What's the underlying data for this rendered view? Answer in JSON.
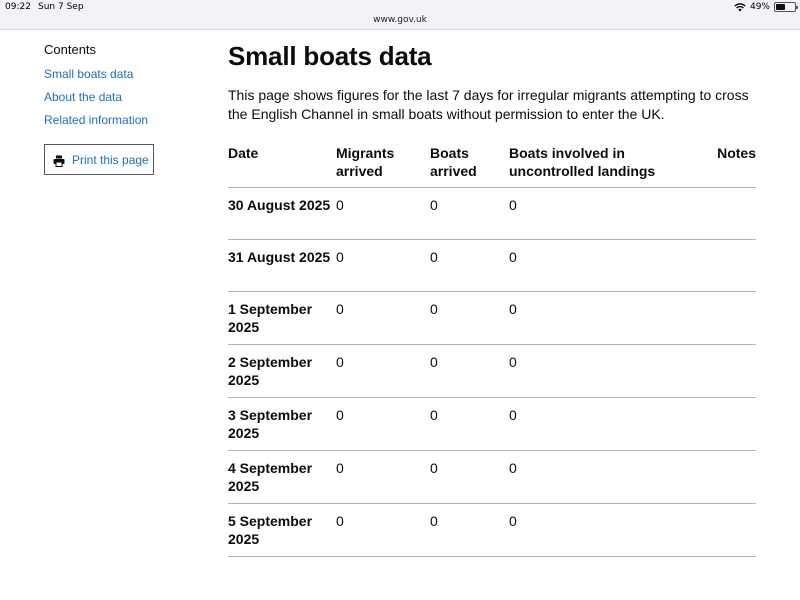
{
  "status_bar": {
    "time": "09:22",
    "date": "Sun 7 Sep",
    "url": "www.gov.uk",
    "battery": "49%",
    "battery_level": 0.49
  },
  "sidebar": {
    "heading": "Contents",
    "items": [
      {
        "label": "Small boats data"
      },
      {
        "label": "About the data"
      },
      {
        "label": "Related information"
      }
    ],
    "print_label": "Print this page"
  },
  "main": {
    "title": "Small boats data",
    "lede": "This page shows figures for the last 7 days for irregular migrants attempting to cross the English Channel in small boats without permission to enter the UK.",
    "table": {
      "headers": {
        "date": "Date",
        "migrants": "Migrants arrived",
        "boats": "Boats arrived",
        "uncontrolled": "Boats involved in uncontrolled landings",
        "notes": "Notes"
      },
      "rows": [
        {
          "date": "30 August 2025",
          "migrants": "0",
          "boats": "0",
          "uncontrolled": "0",
          "notes": ""
        },
        {
          "date": "31 August 2025",
          "migrants": "0",
          "boats": "0",
          "uncontrolled": "0",
          "notes": ""
        },
        {
          "date": "1 September 2025",
          "migrants": "0",
          "boats": "0",
          "uncontrolled": "0",
          "notes": ""
        },
        {
          "date": "2 September 2025",
          "migrants": "0",
          "boats": "0",
          "uncontrolled": "0",
          "notes": ""
        },
        {
          "date": "3 September 2025",
          "migrants": "0",
          "boats": "0",
          "uncontrolled": "0",
          "notes": ""
        },
        {
          "date": "4 September 2025",
          "migrants": "0",
          "boats": "0",
          "uncontrolled": "0",
          "notes": ""
        },
        {
          "date": "5 September 2025",
          "migrants": "0",
          "boats": "0",
          "uncontrolled": "0",
          "notes": ""
        }
      ]
    }
  },
  "colors": {
    "link": "#1d70b8",
    "text": "#0b0c0c",
    "border": "#b1b4b6"
  }
}
